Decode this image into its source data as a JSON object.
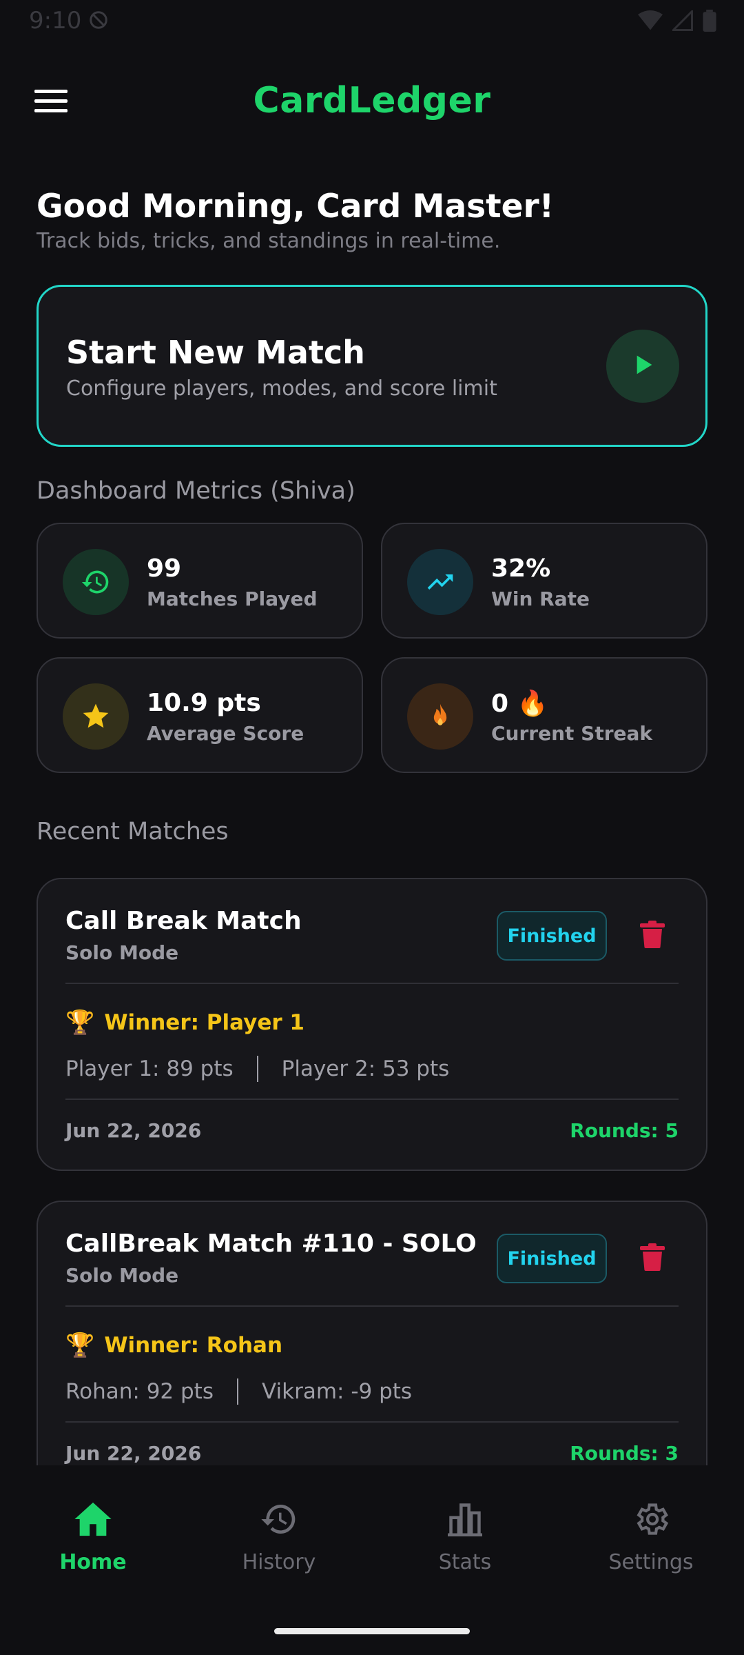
{
  "status_bar": {
    "time": "9:10"
  },
  "app_bar": {
    "title": "CardLedger"
  },
  "greeting": {
    "title": "Good Morning, Card Master!",
    "subtitle": "Track bids, tricks, and standings in real-time."
  },
  "start_match": {
    "title": "Start New Match",
    "subtitle": "Configure players, modes, and score limit"
  },
  "metrics": {
    "section_title": "Dashboard Metrics (Shiva)",
    "items": [
      {
        "value": "99",
        "label": "Matches Played",
        "icon": "history-icon",
        "color": "#1ed46a"
      },
      {
        "value": "32%",
        "label": "Win Rate",
        "icon": "trending-up-icon",
        "color": "#22d3ee"
      },
      {
        "value": "10.9 pts",
        "label": "Average Score",
        "icon": "star-icon",
        "color": "#f5c518"
      },
      {
        "value": "0 🔥",
        "label": "Current Streak",
        "icon": "fire-icon",
        "color": "#f07a1a"
      }
    ]
  },
  "recent": {
    "section_title": "Recent Matches",
    "matches": [
      {
        "title": "Call Break Match",
        "mode": "Solo Mode",
        "status": "Finished",
        "winner": "Winner: Player 1",
        "score_a": "Player 1: 89 pts",
        "score_b": "Player 2: 53 pts",
        "date": "Jun 22, 2026",
        "rounds": "Rounds: 5"
      },
      {
        "title": "CallBreak Match #110 - SOLO",
        "mode": "Solo Mode",
        "status": "Finished",
        "winner": "Winner: Rohan",
        "score_a": "Rohan: 92 pts",
        "score_b": "Vikram: -9 pts",
        "date": "Jun 22, 2026",
        "rounds": "Rounds: 3"
      }
    ]
  },
  "nav": {
    "items": [
      {
        "label": "Home",
        "icon": "home-icon",
        "active": true
      },
      {
        "label": "History",
        "icon": "history-icon",
        "active": false
      },
      {
        "label": "Stats",
        "icon": "bar-chart-icon",
        "active": false
      },
      {
        "label": "Settings",
        "icon": "gear-icon",
        "active": false
      }
    ]
  },
  "colors": {
    "accent": "#1ed46a",
    "outline": "#22d6c8",
    "badge_text": "#22d3ee",
    "winner": "#f5c518",
    "delete": "#d61f45",
    "background": "#0f0f12",
    "card": "#17171b"
  }
}
